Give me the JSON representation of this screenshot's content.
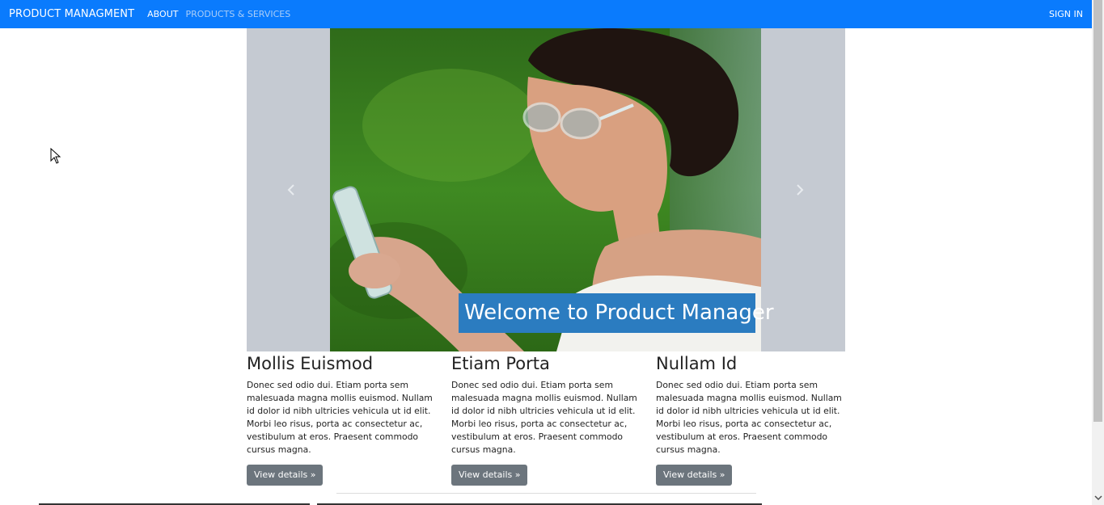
{
  "nav": {
    "brand": "PRODUCT MANAGMENT",
    "about": "ABOUT",
    "products": "PRODUCTS & SERVICES",
    "signin": "SIGN IN"
  },
  "carousel": {
    "caption": "Welcome to Product Manager",
    "prev_icon": "chevron-left-icon",
    "next_icon": "chevron-right-icon"
  },
  "columns": [
    {
      "title": "Mollis Euismod",
      "text": "Donec sed odio dui. Etiam porta sem malesuada magna mollis euismod. Nullam id dolor id nibh ultricies vehicula ut id elit. Morbi leo risus, porta ac consectetur ac, vestibulum at eros. Praesent commodo cursus magna.",
      "button": "View details »"
    },
    {
      "title": "Etiam Porta",
      "text": "Donec sed odio dui. Etiam porta sem malesuada magna mollis euismod. Nullam id dolor id nibh ultricies vehicula ut id elit. Morbi leo risus, porta ac consectetur ac, vestibulum at eros. Praesent commodo cursus magna.",
      "button": "View details »"
    },
    {
      "title": "Nullam Id",
      "text": "Donec sed odio dui. Etiam porta sem malesuada magna mollis euismod. Nullam id dolor id nibh ultricies vehicula ut id elit. Morbi leo risus, porta ac consectetur ac, vestibulum at eros. Praesent commodo cursus magna.",
      "button": "View details »"
    }
  ],
  "colors": {
    "navbar": "#0a7bfd",
    "caption_bg": "#2b7cc0",
    "carousel_bg": "#c5cad2",
    "button_bg": "#6c757d"
  }
}
